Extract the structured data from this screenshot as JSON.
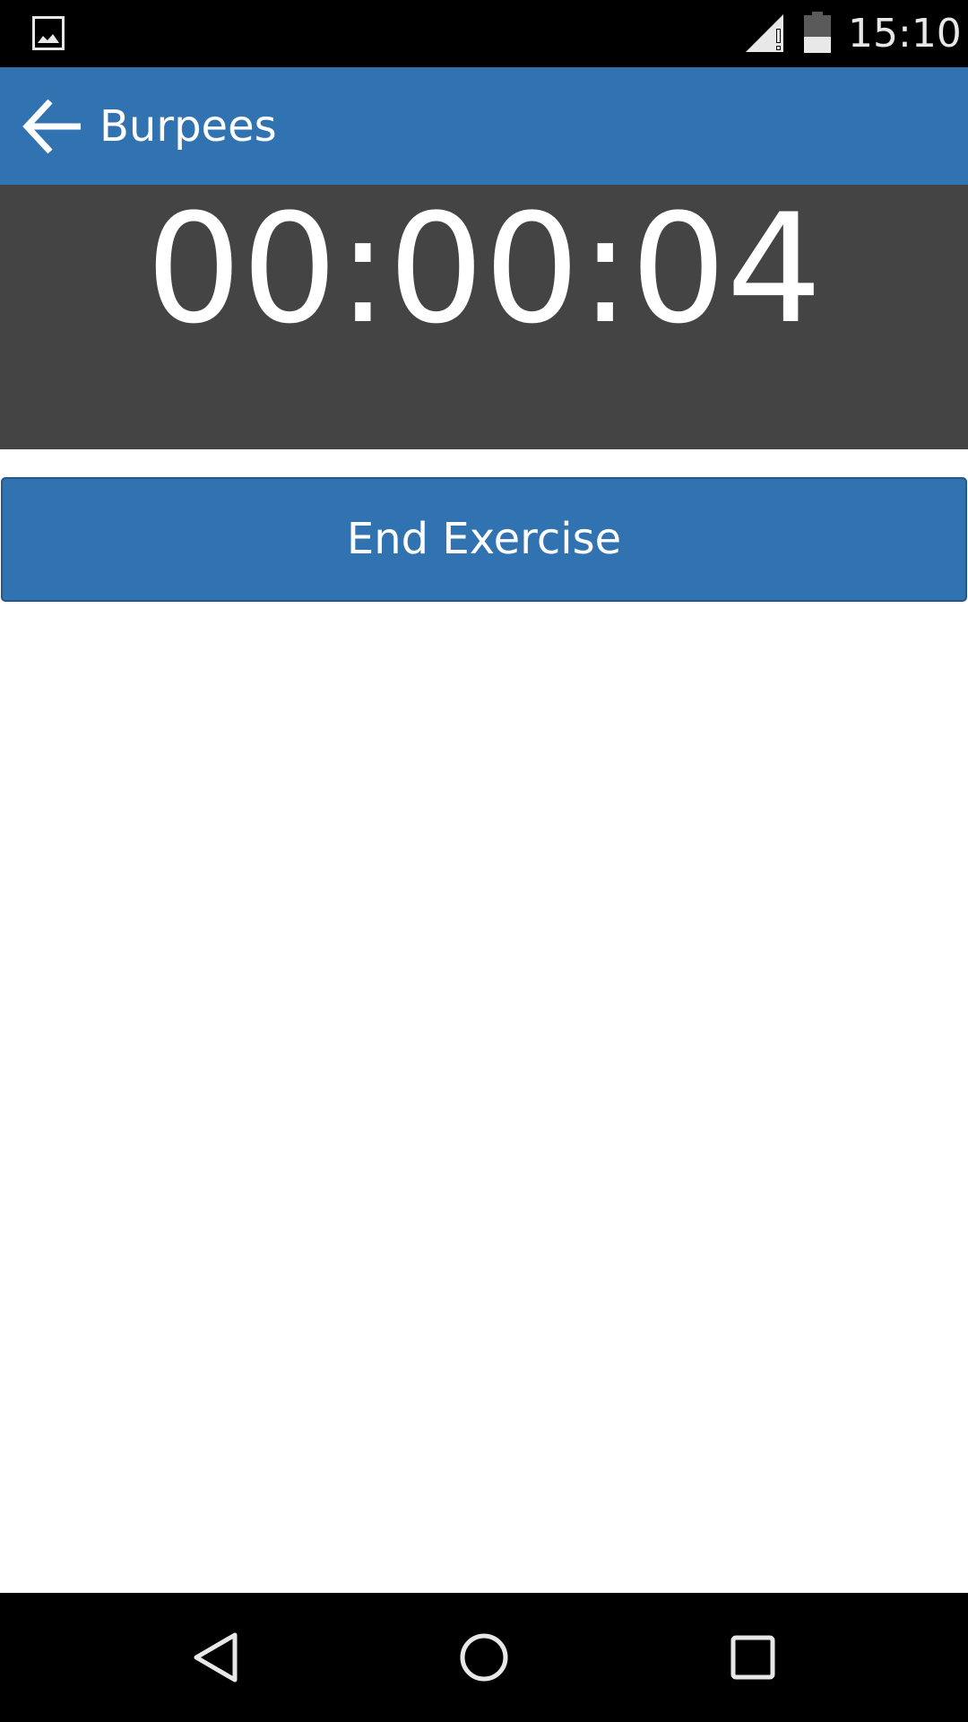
{
  "status_bar": {
    "time": "15:10",
    "icons": [
      "image-notification-icon",
      "signal-icon",
      "battery-icon"
    ]
  },
  "app_bar": {
    "title": "Burpees",
    "back_icon": "arrow-left-icon"
  },
  "timer": {
    "value": "00:00:04"
  },
  "actions": {
    "end_exercise_label": "End Exercise"
  },
  "nav_bar": {
    "icons": [
      "nav-back-icon",
      "nav-home-icon",
      "nav-recents-icon"
    ]
  },
  "colors": {
    "primary": "#3173b0",
    "timer_background": "#444444",
    "system_bar": "#000000",
    "text_on_primary": "#ffffff"
  }
}
